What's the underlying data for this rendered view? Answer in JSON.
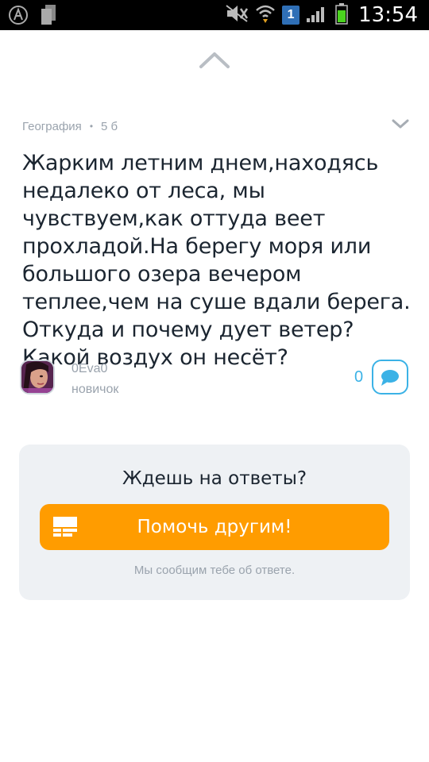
{
  "status_bar": {
    "time": "13:54",
    "notification_count": "1",
    "icons": [
      "app-a-icon",
      "files-icon",
      "mute-icon",
      "wifi-icon",
      "signal-icon",
      "battery-icon"
    ]
  },
  "question": {
    "subject": "География",
    "separator": "•",
    "points": "5 б",
    "text": "Жарким летним днем,находясь недалеко от леса, мы чувствуем,как оттуда веет прохладой.На берегу моря или большого озера вечером теплее,чем на суше вдали берега. Откуда и почему дует ветер? Какой воздух он несёт?"
  },
  "author": {
    "name": "0Eva0",
    "rank": "новичок"
  },
  "comments": {
    "count": "0"
  },
  "card": {
    "title": "Ждешь на ответы?",
    "button_label": "Помочь другим!",
    "note": "Мы сообщим тебе об ответе."
  },
  "colors": {
    "accent_orange": "#ff9c00",
    "accent_blue": "#3bb2e6",
    "muted_text": "#9aa3ad",
    "card_bg": "#eef1f4"
  }
}
